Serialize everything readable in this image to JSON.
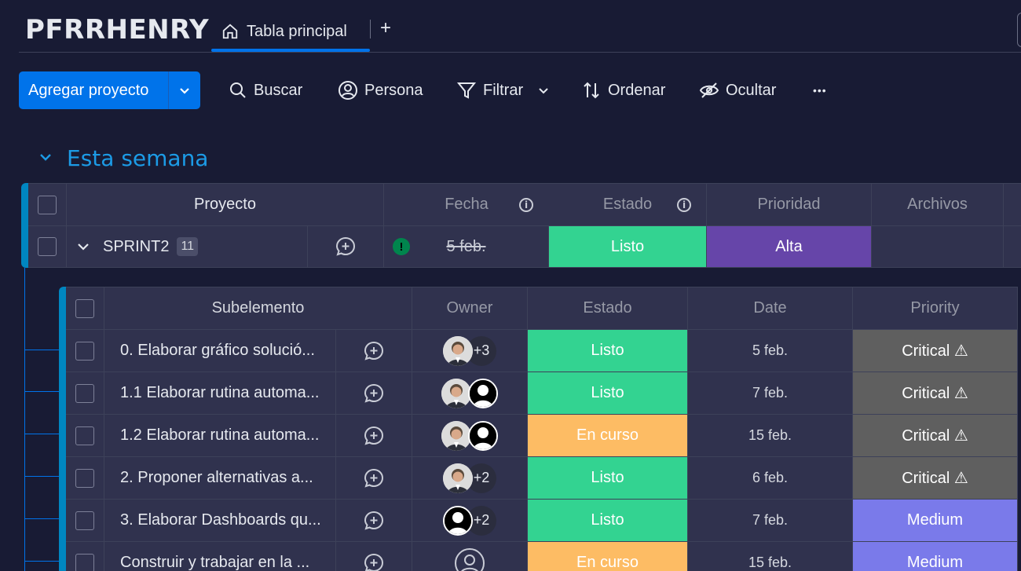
{
  "board": {
    "title": "PFRRHENRY",
    "tab_label": "Tabla principal",
    "tab_add": "+"
  },
  "toolbar": {
    "new_item_label": "Agregar proyecto",
    "search_label": "Buscar",
    "person_label": "Persona",
    "filter_label": "Filtrar",
    "sort_label": "Ordenar",
    "hide_label": "Ocultar",
    "more_label": "•••"
  },
  "group": {
    "title": "Esta semana",
    "columns": {
      "name": "Proyecto",
      "date": "Fecha",
      "status": "Estado",
      "priority": "Prioridad",
      "files": "Archivos"
    },
    "item": {
      "name": "SPRINT2",
      "count": "11",
      "date": "5 feb.",
      "status": "Listo",
      "priority": "Alta",
      "date_warning": "!"
    }
  },
  "subitems": {
    "columns": {
      "name": "Subelemento",
      "owner": "Owner",
      "status": "Estado",
      "date": "Date",
      "priority": "Priority"
    },
    "rows": [
      {
        "name": "0. Elaborar gráfico solució...",
        "extra": "+3",
        "status": "Listo",
        "date": "5 feb.",
        "priority": "Critical ⚠"
      },
      {
        "name": "1.1 Elaborar rutina automa...",
        "extra": "",
        "status": "Listo",
        "date": "7 feb.",
        "priority": "Critical ⚠"
      },
      {
        "name": "1.2 Elaborar rutina automa...",
        "extra": "",
        "status": "En curso",
        "date": "15 feb.",
        "priority": "Critical ⚠"
      },
      {
        "name": "2. Proponer alternativas a...",
        "extra": "+2",
        "status": "Listo",
        "date": "6 feb.",
        "priority": "Critical ⚠"
      },
      {
        "name": "3. Elaborar Dashboards qu...",
        "extra": "+2",
        "status": "Listo",
        "date": "7 feb.",
        "priority": "Medium"
      },
      {
        "name": "Construir y trabajar en la ...",
        "extra": "",
        "status": "En curso",
        "date": "15 feb.",
        "priority": "Medium"
      }
    ]
  },
  "colors": {
    "accent": "#0073ea",
    "status_done": "#33d391",
    "status_working": "#fdbc64",
    "priority_high": "#6645a9",
    "priority_critical": "#5f5f5f",
    "priority_medium": "#7a7aea"
  }
}
